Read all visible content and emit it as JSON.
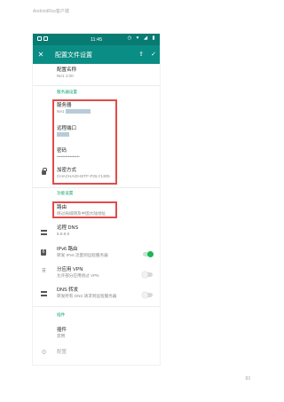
{
  "doc": {
    "header": "AndroidRss客户端",
    "page_number": "83"
  },
  "statusbar": {
    "time": "11:45"
  },
  "toolbar": {
    "title": "配置文件设置",
    "close_icon": "close-icon",
    "share_icon": "share-icon",
    "confirm_icon": "check-icon"
  },
  "profile": {
    "name_title": "配置名称",
    "name_value": "Ne1 1:00"
  },
  "server_section": {
    "header": "服务器设置",
    "server_title": "服务器",
    "server_value": "Ne1",
    "port_title": "远程端口",
    "password_title": "密码",
    "password_value": "••••••••••••••••",
    "method_title": "加密方式",
    "method_value": "CHACHA20-IETF-POLY1305"
  },
  "feature_section": {
    "header": "功能设置",
    "route_title": "路由",
    "route_value": "绕过局域网及中国大陆地址",
    "dns_title": "远程 DNS",
    "dns_value": "8.8.8.8",
    "ipv6_title": "IPv6 路由",
    "ipv6_sub": "转发 IPv6 流量到远程服务器",
    "ipv6_on": true,
    "perapp_title": "分应用 VPN",
    "perapp_sub": "允许部分应用绕过 VPN",
    "perapp_on": false,
    "dnsfwd_title": "DNS 转发",
    "dnsfwd_sub": "转发所有 DNS 请求到远程服务器",
    "dnsfwd_on": false
  },
  "plugin_section": {
    "header": "插件",
    "plugin_title": "插件",
    "plugin_value": "禁用",
    "config_title": "配置"
  },
  "colors": {
    "toolbar": "#0a8d84",
    "statusbar": "#087b73",
    "section": "#17a86f",
    "highlight": "#e24b4b"
  }
}
